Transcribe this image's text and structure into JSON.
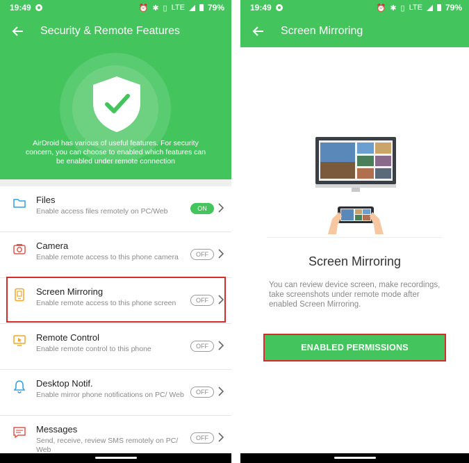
{
  "status_bar": {
    "time": "19:49",
    "network": "LTE",
    "battery": "79%"
  },
  "colors": {
    "brand_green": "#43c45d",
    "highlight_red": "#d62b2b",
    "icon_orange": "#f5a623",
    "icon_blue": "#2ea0e6",
    "icon_red": "#e2574c"
  },
  "left_screen": {
    "title": "Security & Remote Features",
    "hero_description": "AirDroid has various of useful features. For security concern, you can choose to enabled which features can be enabled under remote connection",
    "features": [
      {
        "icon": "folder-icon",
        "title": "Files",
        "subtitle": "Enable access files remotely on PC/Web",
        "toggle": "ON"
      },
      {
        "icon": "camera-icon",
        "title": "Camera",
        "subtitle": "Enable remote access to this phone camera",
        "toggle": "OFF"
      },
      {
        "icon": "screen-mirroring-icon",
        "title": "Screen Mirroring",
        "subtitle": "Enable remote access to this phone screen",
        "toggle": "OFF"
      },
      {
        "icon": "remote-control-icon",
        "title": "Remote Control",
        "subtitle": "Enable remote control to this phone",
        "toggle": "OFF"
      },
      {
        "icon": "bell-icon",
        "title": "Desktop Notif.",
        "subtitle": "Enable mirror phone notifications on PC/ Web",
        "toggle": "OFF"
      },
      {
        "icon": "message-icon",
        "title": "Messages",
        "subtitle": "Send, receive, review SMS remotely on PC/ Web",
        "toggle": "OFF"
      }
    ]
  },
  "right_screen": {
    "title": "Screen Mirroring",
    "heading": "Screen Mirroring",
    "description": "You can review device screen, make recordings, take screenshots under remote mode after enabled Screen Mirroring.",
    "button_label": "ENABLED PERMISSIONS"
  }
}
